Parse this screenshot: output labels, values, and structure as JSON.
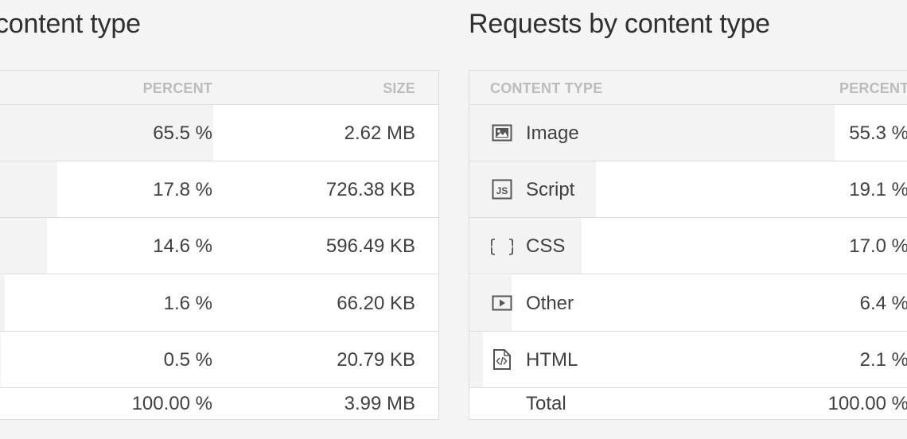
{
  "left_panel": {
    "title": "content type",
    "columns": {
      "percent": "PERCENT",
      "size": "SIZE"
    },
    "rows": [
      {
        "percent": "65.5 %",
        "size": "2.62 MB",
        "share": 0.655
      },
      {
        "percent": "17.8 %",
        "size": "726.38 KB",
        "share": 0.178
      },
      {
        "percent": "14.6 %",
        "size": "596.49 KB",
        "share": 0.146
      },
      {
        "percent": "1.6 %",
        "size": "66.20 KB",
        "share": 0.016
      },
      {
        "percent": "0.5 %",
        "size": "20.79 KB",
        "share": 0.005
      }
    ],
    "total": {
      "percent": "100.00 %",
      "size": "3.99 MB"
    }
  },
  "right_panel": {
    "title": "Requests by content type",
    "columns": {
      "type": "CONTENT TYPE",
      "percent": "PERCENT"
    },
    "rows": [
      {
        "icon": "image-icon",
        "type": "Image",
        "percent": "55.3 %",
        "share": 0.553
      },
      {
        "icon": "script-icon",
        "type": "Script",
        "percent": "19.1 %",
        "share": 0.191
      },
      {
        "icon": "css-icon",
        "type": "CSS",
        "percent": "17.0 %",
        "share": 0.17
      },
      {
        "icon": "other-icon",
        "type": "Other",
        "percent": "6.4 %",
        "share": 0.064
      },
      {
        "icon": "html-icon",
        "type": "HTML",
        "percent": "2.1 %",
        "share": 0.021
      }
    ],
    "total": {
      "type": "Total",
      "percent": "100.00 %"
    }
  },
  "colors": {
    "bar": "#f3f3f3",
    "border": "#dcdcdc",
    "header_text": "#bcbcbc"
  }
}
